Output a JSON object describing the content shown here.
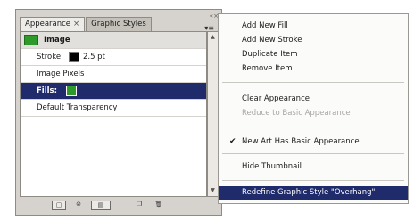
{
  "panel": {
    "tabs": [
      {
        "label": "Appearance",
        "close": "×"
      },
      {
        "label": "Graphic Styles"
      }
    ],
    "grip": "« ×",
    "menu_button": "▾≡",
    "rows": {
      "object": "Image",
      "stroke_label": "Stroke:",
      "stroke_value": "2.5 pt",
      "pixels": "Image Pixels",
      "fills_label": "Fills:",
      "transparency": "Default Transparency"
    },
    "colors": {
      "fill": "#2e9a2a",
      "stroke": "#000000",
      "selection": "#1f2b6a"
    }
  },
  "menu": {
    "items": [
      "Add New Fill",
      "Add New Stroke",
      "Duplicate Item",
      "Remove Item",
      "Clear Appearance",
      "Reduce to Basic Appearance",
      "New Art Has Basic Appearance",
      "Hide Thumbnail",
      "Redefine Graphic Style \"Overhang\""
    ],
    "check": "✔"
  }
}
